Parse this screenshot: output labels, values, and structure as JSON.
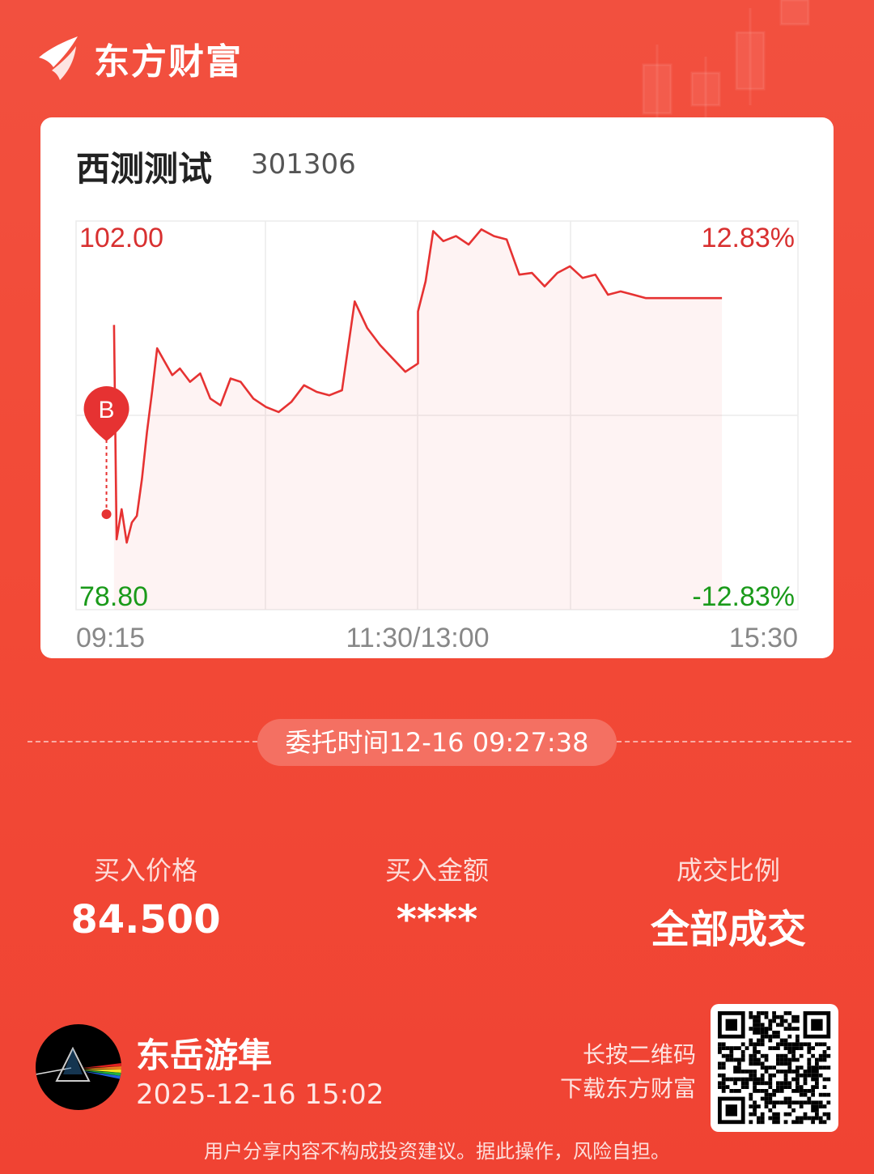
{
  "brand": {
    "name": "东方财富",
    "logo_icon": "eastmoney-logo-icon"
  },
  "stock": {
    "name": "西测测试",
    "code": "301306"
  },
  "chart_data": {
    "type": "line",
    "price_high_label": "102.00",
    "price_low_label": "78.80",
    "pct_high_label": "12.83%",
    "pct_low_label": "-12.83%",
    "x_tick_labels": [
      "09:15",
      "11:30/13:00",
      "15:30"
    ],
    "ylim": [
      78.8,
      102.0
    ],
    "prev_close": 90.4,
    "buy_marker": {
      "label": "B",
      "time": "09:27",
      "price": 84.5
    },
    "series": [
      {
        "x": [
          "09:30",
          "09:31",
          "09:33",
          "09:35",
          "09:37",
          "09:39",
          "09:41",
          "09:43",
          "09:45",
          "09:47",
          "09:50",
          "09:53",
          "09:56",
          "10:00",
          "10:04",
          "10:08",
          "10:12",
          "10:16",
          "10:20",
          "10:25",
          "10:30",
          "10:35",
          "10:40",
          "10:45",
          "10:50",
          "10:55",
          "11:00",
          "11:05",
          "11:10",
          "11:15",
          "11:20",
          "11:25",
          "11:30",
          "13:00",
          "13:03",
          "13:06",
          "13:10",
          "13:15",
          "13:20",
          "13:25",
          "13:30",
          "13:35",
          "13:40",
          "13:45",
          "13:50",
          "13:55",
          "14:00",
          "14:05",
          "14:10",
          "14:15",
          "14:20",
          "14:25",
          "14:30",
          "14:35",
          "14:40",
          "14:45",
          "14:50",
          "14:55",
          "15:00"
        ],
        "values": [
          95.8,
          83.0,
          84.8,
          82.8,
          84.0,
          84.4,
          86.6,
          89.4,
          91.8,
          94.4,
          93.6,
          92.8,
          93.2,
          92.4,
          92.9,
          91.4,
          91.0,
          92.6,
          92.4,
          91.4,
          90.9,
          90.6,
          91.2,
          92.2,
          91.8,
          91.6,
          91.9,
          97.2,
          95.6,
          94.6,
          93.8,
          93.0,
          93.5,
          96.6,
          98.4,
          101.4,
          100.8,
          101.1,
          100.6,
          101.5,
          101.1,
          100.9,
          98.8,
          98.9,
          98.1,
          98.9,
          99.3,
          98.6,
          98.8,
          97.6,
          97.8,
          97.6,
          97.4,
          97.4,
          97.4,
          97.4,
          97.4,
          97.4,
          97.4
        ]
      }
    ]
  },
  "order_time": "委托时间12-16 09:27:38",
  "stats": [
    {
      "label": "买入价格",
      "value": "84.500"
    },
    {
      "label": "买入金额",
      "value": "****"
    },
    {
      "label": "成交比例",
      "value": "全部成交"
    }
  ],
  "user": {
    "name": "东岳游隼",
    "time": "2025-12-16 15:02",
    "avatar_icon": "prism-avatar-icon"
  },
  "qr": {
    "hint_line1": "长按二维码",
    "hint_line2": "下载东方财富",
    "icon": "qr-code-icon"
  },
  "disclaimer": "用户分享内容不构成投资建议。据此操作，风险自担。",
  "colors": {
    "up": "#e03030",
    "down": "#1a9a1a",
    "line": "#e63232",
    "bg": "#f24a37"
  }
}
